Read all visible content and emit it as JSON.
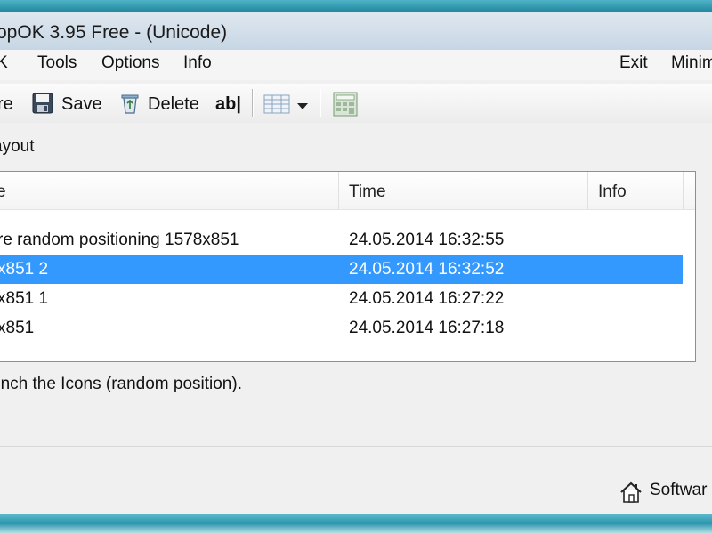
{
  "window": {
    "title": "opOK 3.95 Free - (Unicode)"
  },
  "menu": {
    "items": [
      "K",
      "Tools",
      "Options",
      "Info"
    ],
    "exit": "Exit",
    "minimize": "Minim"
  },
  "toolbar": {
    "restore_label": "re",
    "save_label": "Save",
    "delete_label": "Delete",
    "rename_label": "ab|"
  },
  "layout_label": "ayout",
  "list": {
    "columns": [
      "e",
      "Time",
      "Info"
    ],
    "rows": [
      {
        "name": "re random positioning 1578x851",
        "time": "24.05.2014 16:32:55",
        "info": "",
        "selected": false
      },
      {
        "name": "x851 2",
        "time": "24.05.2014 16:32:52",
        "info": "",
        "selected": true
      },
      {
        "name": "x851 1",
        "time": "24.05.2014 16:27:22",
        "info": "",
        "selected": false
      },
      {
        "name": "x851",
        "time": "24.05.2014 16:27:18",
        "info": "",
        "selected": false
      }
    ]
  },
  "status_text": "unch the Icons (random position).",
  "footer": {
    "software_label": "Softwar"
  },
  "colors": {
    "selection": "#3399ff",
    "desktop": "#2b8fa8"
  },
  "icons": {
    "save": "floppy-disk-icon",
    "delete": "recycle-bin-icon",
    "view": "grid-view-icon",
    "calculator": "calculator-icon",
    "home": "house-icon"
  }
}
